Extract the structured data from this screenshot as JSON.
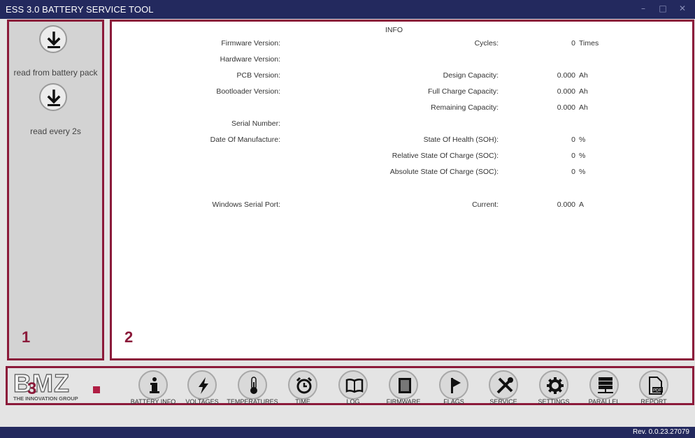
{
  "window": {
    "title": "ESS 3.0 BATTERY SERVICE TOOL",
    "minimize": "–",
    "maximize": "□",
    "close": "✕"
  },
  "sidebar": {
    "read_pack_label": "read from battery pack",
    "read_every_label": "read every 2s",
    "marker": "1"
  },
  "info": {
    "header": "INFO",
    "marker": "2",
    "left_labels": {
      "firmware": "Firmware Version:",
      "hardware": "Hardware Version:",
      "pcb": "PCB Version:",
      "bootloader": "Bootloader Version:",
      "serial": "Serial Number:",
      "dom": "Date Of Manufacture:",
      "port": "Windows Serial Port:"
    },
    "rows": {
      "cycles": {
        "label": "Cycles:",
        "value": "0",
        "unit": "Times"
      },
      "design": {
        "label": "Design Capacity:",
        "value": "0.000",
        "unit": "Ah"
      },
      "full": {
        "label": "Full Charge Capacity:",
        "value": "0.000",
        "unit": "Ah"
      },
      "remaining": {
        "label": "Remaining Capacity:",
        "value": "0.000",
        "unit": "Ah"
      },
      "soh": {
        "label": "State Of Health (SOH):",
        "value": "0",
        "unit": "%"
      },
      "rsoc": {
        "label": "Relative State Of Charge (SOC):",
        "value": "0",
        "unit": "%"
      },
      "asoc": {
        "label": "Absolute State Of Charge (SOC):",
        "value": "0",
        "unit": "%"
      },
      "current": {
        "label": "Current:",
        "value": "0.000",
        "unit": "A"
      }
    }
  },
  "toolbar": {
    "logo_text": "BMZ",
    "logo_tagline": "THE INNOVATION GROUP",
    "marker": "3",
    "items": [
      {
        "label": "BATTERY INFO",
        "icon": "info-icon"
      },
      {
        "label": "VOLTAGES",
        "icon": "lightning-icon"
      },
      {
        "label": "TEMPERATURES",
        "icon": "thermometer-icon"
      },
      {
        "label": "TIME",
        "icon": "alarm-clock-icon"
      },
      {
        "label": "LOG",
        "icon": "book-icon"
      },
      {
        "label": "FIRMWARE",
        "icon": "chip-icon"
      },
      {
        "label": "FLAGS",
        "icon": "flag-icon"
      },
      {
        "label": "SERVICE",
        "icon": "tools-icon"
      },
      {
        "label": "SETTINGS",
        "icon": "gear-icon"
      },
      {
        "label": "PARALLEL",
        "icon": "server-icon"
      },
      {
        "label": "REPORT",
        "icon": "pdf-icon"
      }
    ]
  },
  "status": {
    "revision": "Rev. 0.0.23.27079"
  },
  "colors": {
    "titlebar": "#23295e",
    "accent_border": "#8b1a3a",
    "logo_square": "#b01e44"
  }
}
